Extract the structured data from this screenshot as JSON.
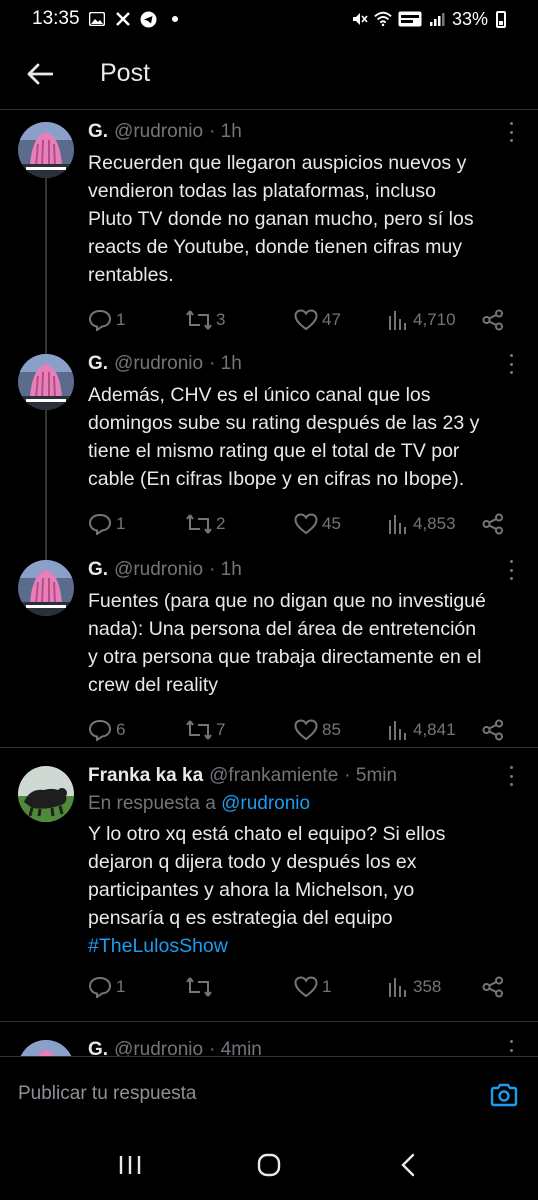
{
  "status_bar": {
    "time": "13:35",
    "battery": "33%"
  },
  "header": {
    "title": "Post"
  },
  "tweets": [
    {
      "name": "G.",
      "handle": "@rudronio",
      "time": "· 1h",
      "lines": [
        "Recuerden que llegaron auspicios nuevos y",
        "vendieron todas las plataformas, incluso",
        "Pluto TV donde no ganan mucho, pero sí los",
        "reacts de Youtube, donde tienen cifras muy",
        "rentables."
      ],
      "replies": "1",
      "reposts": "3",
      "likes": "47",
      "views": "4,710"
    },
    {
      "name": "G.",
      "handle": "@rudronio",
      "time": "· 1h",
      "lines": [
        "Además, CHV es el único canal que los",
        "domingos sube su rating después de las 23 y",
        "tiene el mismo rating que el total de TV por",
        "cable (En cifras Ibope y en cifras no Ibope)."
      ],
      "replies": "1",
      "reposts": "2",
      "likes": "45",
      "views": "4,853"
    },
    {
      "name": "G.",
      "handle": "@rudronio",
      "time": "· 1h",
      "lines": [
        "Fuentes (para que no digan que no investigué",
        "nada): Una persona del área de entretención",
        "y otra persona que trabaja directamente en el",
        "crew del reality"
      ],
      "replies": "6",
      "reposts": "7",
      "likes": "85",
      "views": "4,841"
    },
    {
      "name": "Franka ka ka",
      "handle": "@frankamiente",
      "time": "· 5min",
      "reply_to_label": "En respuesta a",
      "reply_to_handle": "@rudronio",
      "lines": [
        "Y lo otro xq está chato el equipo? Si ellos",
        "dejaron q dijera todo y después los ex",
        "participantes y ahora la Michelson, yo",
        "pensaría q es estrategia del equipo"
      ],
      "hashtag": "#TheLulosShow",
      "replies": "1",
      "reposts": "",
      "likes": "1",
      "views": "358"
    },
    {
      "name": "G.",
      "handle": "@rudronio",
      "time": "· 4min"
    }
  ],
  "compose": {
    "placeholder": "Publicar tu respuesta"
  },
  "icons": {
    "back": "arrow-left-icon",
    "reply": "speech-bubble-icon",
    "repost": "repost-arrows-icon",
    "like": "heart-icon",
    "views": "bar-chart-icon",
    "share": "share-icon",
    "camera": "camera-icon"
  },
  "colors": {
    "background": "#000000",
    "text": "#e7e9ea",
    "muted": "#71767b",
    "link": "#1d9bf0",
    "divider": "#2f3336"
  }
}
